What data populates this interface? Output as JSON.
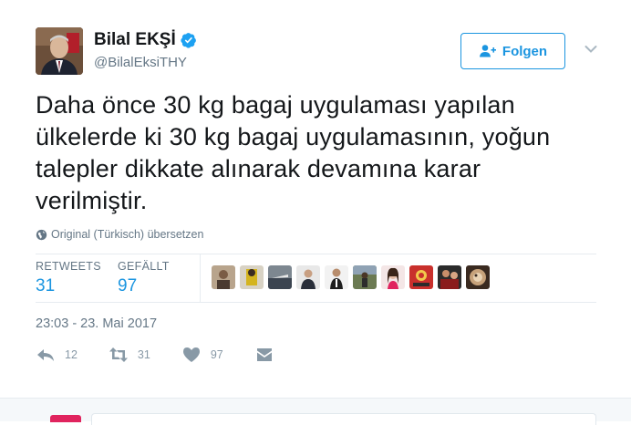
{
  "user": {
    "display_name": "Bilal EKŞİ",
    "handle": "@BilalEksiTHY",
    "verified": true
  },
  "follow_button": {
    "label": "Folgen",
    "icon": "add-user-icon"
  },
  "tweet": {
    "text": "Daha önce 30 kg bagaj uygulaması yapılan ülkelerde ki 30 kg bagaj uygulamasının, yoğun talepler dikkate alınarak devamına karar verilmiştir.",
    "translate_label": "Original (Türkisch) übersetzen"
  },
  "stats": {
    "retweets_label": "RETWEETS",
    "retweets_value": "31",
    "likes_label": "GEFÄLLT",
    "likes_value": "97"
  },
  "likers": [
    {
      "name": "liker-1"
    },
    {
      "name": "liker-2"
    },
    {
      "name": "liker-3"
    },
    {
      "name": "liker-4"
    },
    {
      "name": "liker-5"
    },
    {
      "name": "liker-6"
    },
    {
      "name": "liker-7"
    },
    {
      "name": "liker-8"
    },
    {
      "name": "liker-9"
    },
    {
      "name": "liker-10"
    }
  ],
  "timestamp": "23:03 - 23. Mai 2017",
  "actions": {
    "reply_count": "12",
    "retweet_count": "31",
    "like_count": "97"
  },
  "colors": {
    "accent": "#1b95e0",
    "muted": "#657786",
    "text": "#14171a",
    "action_icon": "#8899a6"
  }
}
